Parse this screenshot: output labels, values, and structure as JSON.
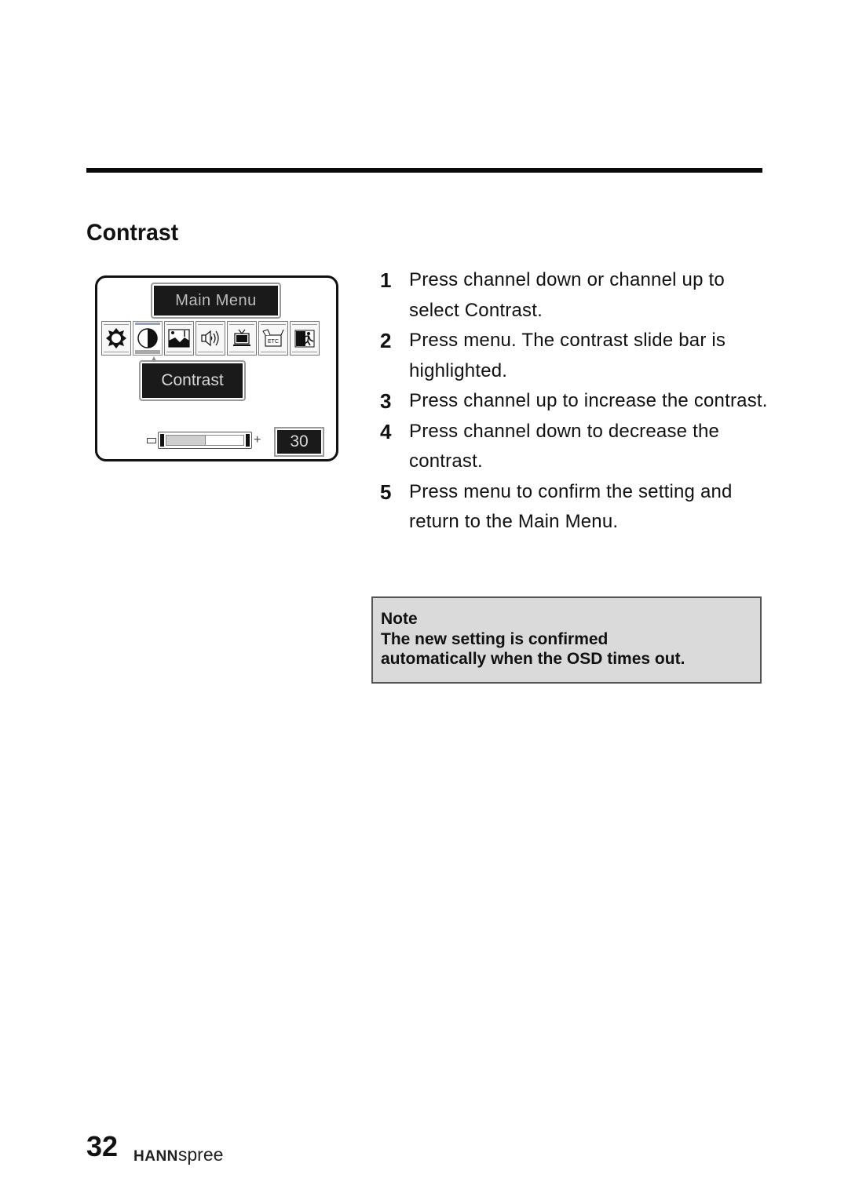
{
  "section": {
    "title": "Contrast"
  },
  "osd": {
    "title": "Main Menu",
    "icons": [
      {
        "name": "brightness-icon",
        "selected": false
      },
      {
        "name": "contrast-icon",
        "selected": true
      },
      {
        "name": "picture-icon",
        "selected": false
      },
      {
        "name": "audio-icon",
        "selected": false
      },
      {
        "name": "tv-icon",
        "selected": false
      },
      {
        "name": "etc-icon",
        "selected": false,
        "label": "ETC"
      },
      {
        "name": "exit-icon",
        "selected": false
      }
    ],
    "submenu_label": "Contrast",
    "slider": {
      "value": 30,
      "fill_fraction": 0.5,
      "minus_glyph": "−",
      "plus_glyph": "+"
    },
    "value_display": "30"
  },
  "steps": [
    {
      "num": "1",
      "text": "Press channel down or channel up to select Contrast."
    },
    {
      "num": "2",
      "text": "Press menu. The contrast slide bar is highlighted."
    },
    {
      "num": "3",
      "text": "Press channel up to increase the contrast."
    },
    {
      "num": "4",
      "text": "Press channel down to decrease the contrast."
    },
    {
      "num": "5",
      "text": "Press menu to confirm the setting and return to the Main Menu."
    }
  ],
  "note": {
    "heading": "Note",
    "line1": "The new setting is confirmed",
    "line2": "automatically when the OSD times out."
  },
  "footer": {
    "page_number": "32",
    "brand_bold": "HANN",
    "brand_light": "spree"
  }
}
